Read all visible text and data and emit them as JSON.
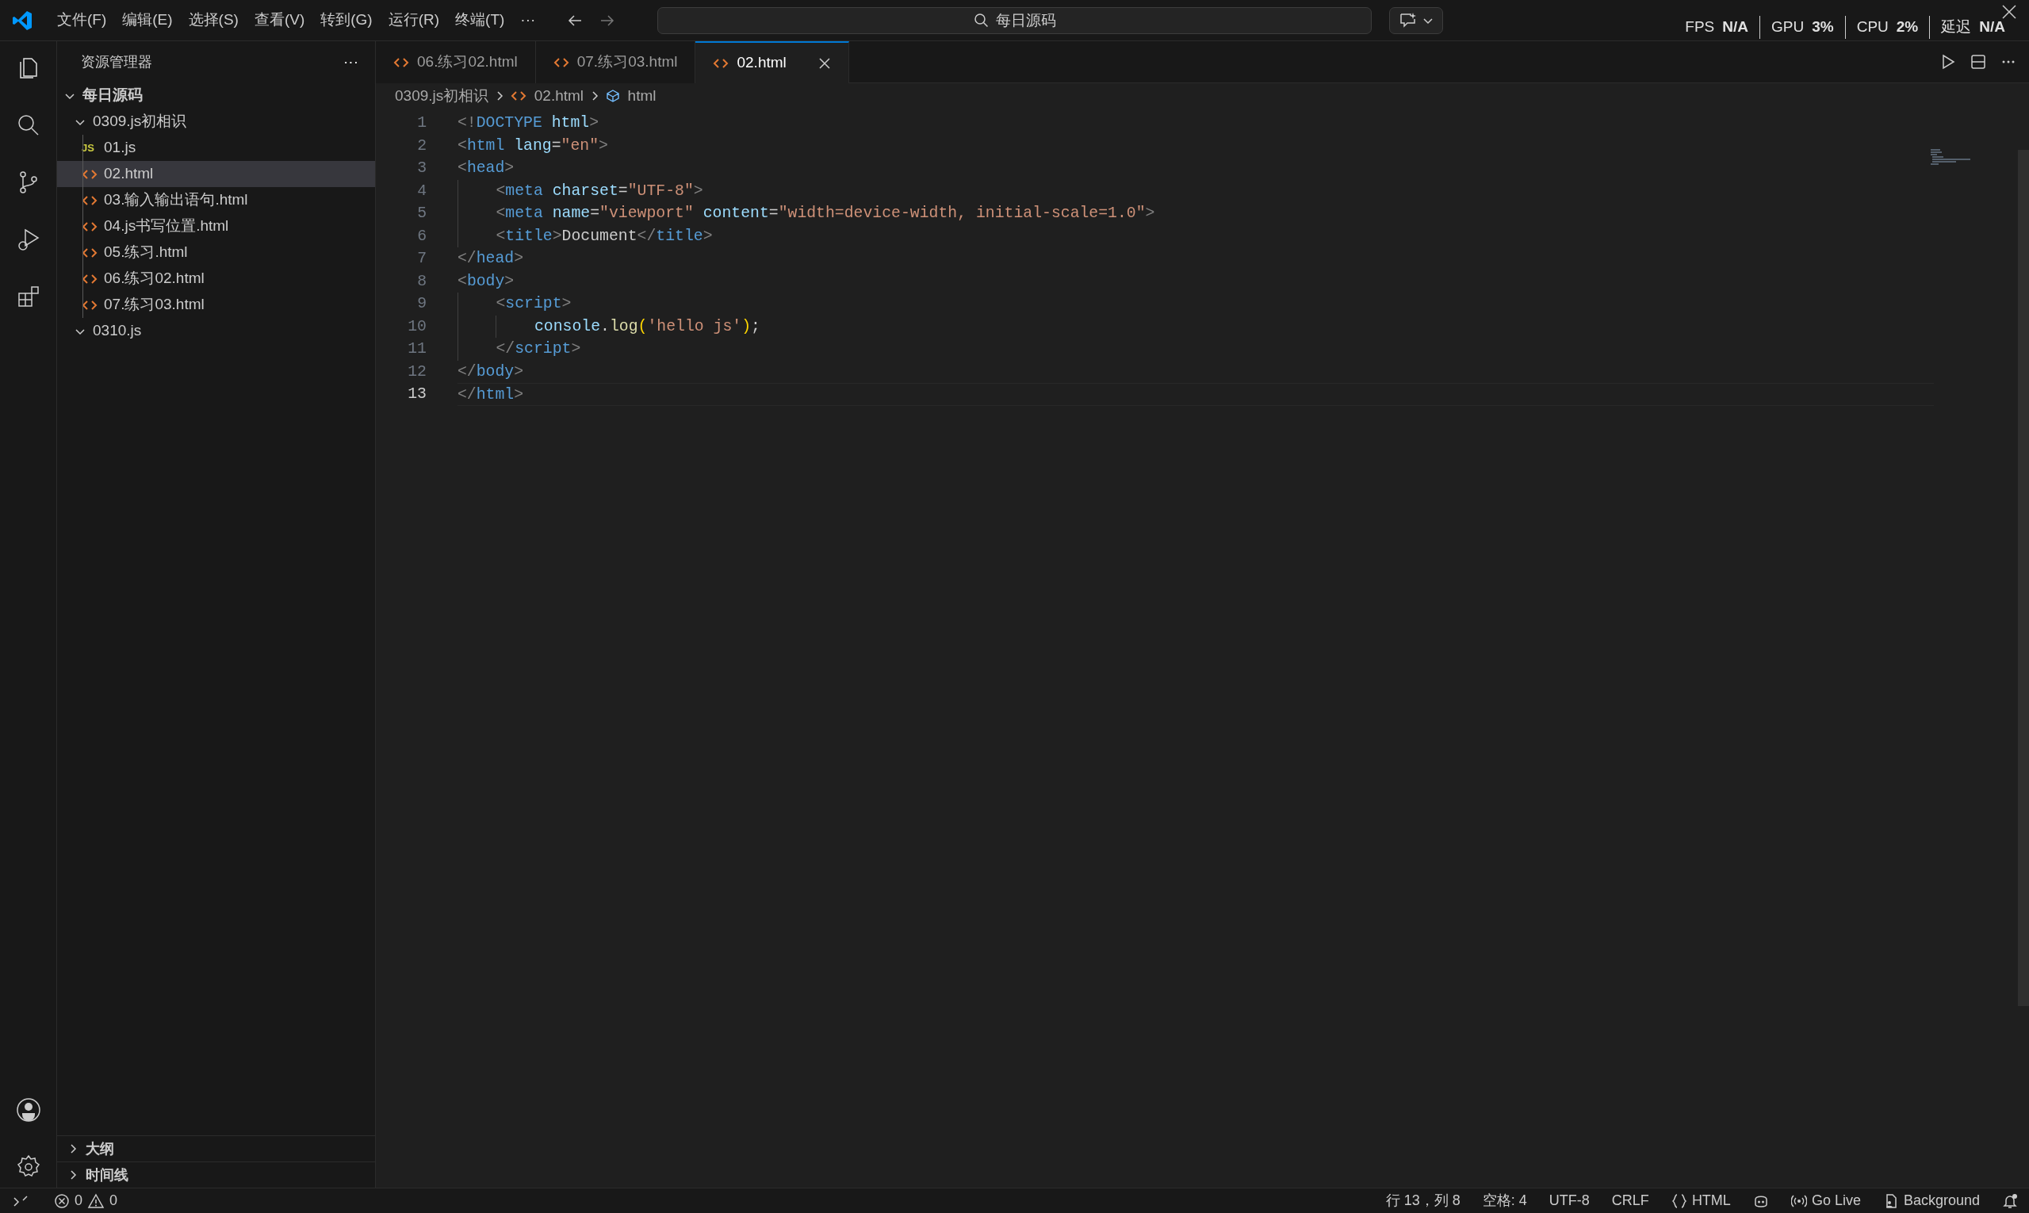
{
  "title_bar": {
    "menus": [
      "文件(F)",
      "编辑(E)",
      "选择(S)",
      "查看(V)",
      "转到(G)",
      "运行(R)",
      "终端(T)"
    ],
    "overflow": "···",
    "search": {
      "value": "每日源码"
    },
    "perf_overlay": [
      {
        "label": "FPS",
        "value": "N/A"
      },
      {
        "label": "GPU",
        "value": "3%"
      },
      {
        "label": "CPU",
        "value": "2%"
      },
      {
        "label": "延迟",
        "value": "N/A"
      }
    ]
  },
  "explorer": {
    "title": "资源管理器",
    "more": "···",
    "tree": [
      {
        "label": "每日源码",
        "kind": "root",
        "expanded": true,
        "children": [
          {
            "label": "0309.js初相识",
            "kind": "folder",
            "expanded": true,
            "children": [
              {
                "label": "01.js",
                "kind": "js",
                "badge": "JS",
                "selected": false
              },
              {
                "label": "02.html",
                "kind": "html",
                "selected": true
              },
              {
                "label": "03.输入输出语句.html",
                "kind": "html",
                "selected": false
              },
              {
                "label": "04.js书写位置.html",
                "kind": "html",
                "selected": false
              },
              {
                "label": "05.练习.html",
                "kind": "html",
                "selected": false
              },
              {
                "label": "06.练习02.html",
                "kind": "html",
                "selected": false
              },
              {
                "label": "07.练习03.html",
                "kind": "html",
                "selected": false
              }
            ]
          },
          {
            "label": "0310.js",
            "kind": "folder",
            "expanded": true
          }
        ]
      }
    ],
    "sections": [
      {
        "label": "大纲",
        "expanded": false
      },
      {
        "label": "时间线",
        "expanded": false
      }
    ]
  },
  "tabs": [
    {
      "label": "06.练习02.html",
      "selected": false
    },
    {
      "label": "07.练习03.html",
      "selected": false
    },
    {
      "label": "02.html",
      "selected": true
    }
  ],
  "breadcrumb": [
    {
      "label": "0309.js初相识",
      "kind": "folder"
    },
    {
      "label": "02.html",
      "kind": "html"
    },
    {
      "label": "html",
      "kind": "element"
    }
  ],
  "code": [
    {
      "number": "1",
      "current": false,
      "tokens": [
        {
          "kind": "punct",
          "t": "<!"
        },
        {
          "kind": "tag",
          "t": "DOCTYPE"
        },
        {
          "kind": "attr",
          "t": " html"
        },
        {
          "kind": "punct",
          "t": ">"
        }
      ]
    },
    {
      "number": "2",
      "current": false,
      "tokens": [
        {
          "kind": "punct",
          "t": "<"
        },
        {
          "kind": "tag",
          "t": "html"
        },
        {
          "kind": "attr",
          "t": " lang"
        },
        {
          "kind": "text",
          "t": "="
        },
        {
          "kind": "string",
          "t": "\"en\""
        },
        {
          "kind": "punct",
          "t": ">"
        }
      ]
    },
    {
      "number": "3",
      "current": false,
      "tokens": [
        {
          "kind": "punct",
          "t": "<"
        },
        {
          "kind": "tag",
          "t": "head"
        },
        {
          "kind": "punct",
          "t": ">"
        }
      ]
    },
    {
      "number": "4",
      "current": false,
      "tokens": [
        {
          "kind": "punct",
          "t": "    <"
        },
        {
          "kind": "tag",
          "t": "meta"
        },
        {
          "kind": "attr",
          "t": " charset"
        },
        {
          "kind": "text",
          "t": "="
        },
        {
          "kind": "string",
          "t": "\"UTF-8\""
        },
        {
          "kind": "punct",
          "t": ">"
        }
      ]
    },
    {
      "number": "5",
      "current": false,
      "tokens": [
        {
          "kind": "punct",
          "t": "    <"
        },
        {
          "kind": "tag",
          "t": "meta"
        },
        {
          "kind": "attr",
          "t": " name"
        },
        {
          "kind": "text",
          "t": "="
        },
        {
          "kind": "string",
          "t": "\"viewport\""
        },
        {
          "kind": "attr",
          "t": " content"
        },
        {
          "kind": "text",
          "t": "="
        },
        {
          "kind": "string",
          "t": "\"width=device-width, initial-scale=1.0\""
        },
        {
          "kind": "punct",
          "t": ">"
        }
      ]
    },
    {
      "number": "6",
      "current": false,
      "tokens": [
        {
          "kind": "punct",
          "t": "    <"
        },
        {
          "kind": "tag",
          "t": "title"
        },
        {
          "kind": "punct",
          "t": ">"
        },
        {
          "kind": "text",
          "t": "Document"
        },
        {
          "kind": "punct",
          "t": "</"
        },
        {
          "kind": "tag",
          "t": "title"
        },
        {
          "kind": "punct",
          "t": ">"
        }
      ]
    },
    {
      "number": "7",
      "current": false,
      "tokens": [
        {
          "kind": "punct",
          "t": "</"
        },
        {
          "kind": "tag",
          "t": "head"
        },
        {
          "kind": "punct",
          "t": ">"
        }
      ]
    },
    {
      "number": "8",
      "current": false,
      "tokens": [
        {
          "kind": "punct",
          "t": "<"
        },
        {
          "kind": "tag",
          "t": "body"
        },
        {
          "kind": "punct",
          "t": ">"
        }
      ]
    },
    {
      "number": "9",
      "current": false,
      "tokens": [
        {
          "kind": "punct",
          "t": "    <"
        },
        {
          "kind": "tag",
          "t": "script"
        },
        {
          "kind": "punct",
          "t": ">"
        }
      ]
    },
    {
      "number": "10",
      "current": false,
      "tokens": [
        {
          "kind": "var",
          "t": "        console"
        },
        {
          "kind": "text",
          "t": "."
        },
        {
          "kind": "func",
          "t": "log"
        },
        {
          "kind": "paren",
          "t": "("
        },
        {
          "kind": "string",
          "t": "'hello js'"
        },
        {
          "kind": "paren",
          "t": ")"
        },
        {
          "kind": "text",
          "t": ";"
        }
      ]
    },
    {
      "number": "11",
      "current": false,
      "tokens": [
        {
          "kind": "punct",
          "t": "    </"
        },
        {
          "kind": "tag",
          "t": "script"
        },
        {
          "kind": "punct",
          "t": ">"
        }
      ]
    },
    {
      "number": "12",
      "current": false,
      "tokens": [
        {
          "kind": "punct",
          "t": "</"
        },
        {
          "kind": "tag",
          "t": "body"
        },
        {
          "kind": "punct",
          "t": ">"
        }
      ]
    },
    {
      "number": "13",
      "current": true,
      "tokens": [
        {
          "kind": "punct",
          "t": "</"
        },
        {
          "kind": "tag",
          "t": "html"
        },
        {
          "kind": "punct",
          "t": ">"
        }
      ]
    }
  ],
  "status_bar": {
    "errors": "0",
    "warnings": "0",
    "items": [
      {
        "kind": "text",
        "label": "行 13，列 8"
      },
      {
        "kind": "text",
        "label": "空格: 4"
      },
      {
        "kind": "text",
        "label": "UTF-8"
      },
      {
        "kind": "text",
        "label": "CRLF"
      },
      {
        "kind": "language",
        "label": "HTML"
      },
      {
        "kind": "copilot"
      },
      {
        "kind": "broadcast",
        "label": "Go Live"
      },
      {
        "kind": "background",
        "label": "Background"
      },
      {
        "kind": "bell"
      }
    ]
  }
}
